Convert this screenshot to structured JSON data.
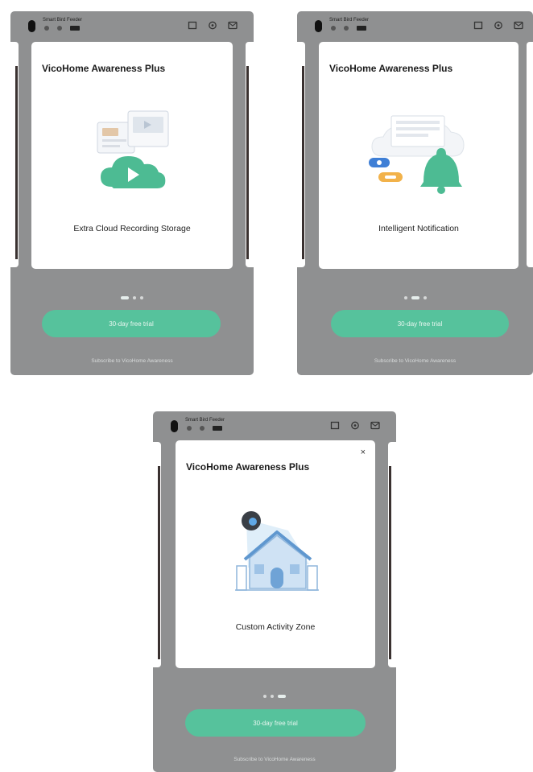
{
  "screens": [
    {
      "device_name": "Smart Bird Feeder",
      "title": "VicoHome Awareness Plus",
      "feature": "Extra Cloud Recording Storage",
      "illustration": "cloud-recording-illustration",
      "active_page": 0,
      "pages": 3,
      "trial_button": "30-day free trial",
      "subscribe_text": "Subscribe to VicoHome Awareness"
    },
    {
      "device_name": "Smart Bird Feeder",
      "title": "VicoHome Awareness Plus",
      "feature": "Intelligent Notification",
      "illustration": "notification-bell-illustration",
      "active_page": 1,
      "pages": 3,
      "trial_button": "30-day free trial",
      "subscribe_text": "Subscribe to VicoHome Awareness"
    },
    {
      "device_name": "Smart Bird Feeder",
      "title": "VicoHome Awareness Plus",
      "feature": "Custom Activity Zone",
      "illustration": "activity-zone-illustration",
      "active_page": 2,
      "pages": 3,
      "trial_button": "30-day free trial",
      "subscribe_text": "Subscribe to VicoHome Awareness",
      "close_symbol": "×"
    }
  ],
  "colors": {
    "backdrop": "#8f9091",
    "accent": "#56c29c",
    "card": "#ffffff"
  },
  "icons": [
    "crop-icon",
    "settings-icon",
    "mail-icon",
    "close-icon"
  ]
}
